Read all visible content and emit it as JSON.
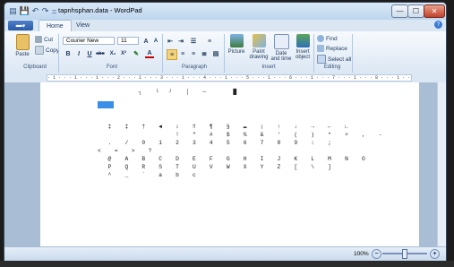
{
  "window": {
    "title": "tapnhsphan.data - WordPad",
    "controls": {
      "minimize": "—",
      "maximize": "☐",
      "close": "✕"
    }
  },
  "quick_access": {
    "save_icon": "💾",
    "undo_icon": "↶",
    "redo_icon": "↷",
    "menu_icon": "="
  },
  "tabs": {
    "file": "▾",
    "home": "Home",
    "view": "View",
    "help": "?"
  },
  "clipboard": {
    "paste": "Paste",
    "cut": "Cut",
    "copy": "Copy",
    "label": "Clipboard"
  },
  "font": {
    "family": "Courier New",
    "size": "11",
    "label": "Font",
    "bold": "B",
    "italic": "I",
    "underline": "U",
    "strike": "abc",
    "subscript": "X₂",
    "superscript": "X²",
    "grow": "A",
    "shrink": "A"
  },
  "paragraph": {
    "label": "Paragraph"
  },
  "insert": {
    "picture": "Picture",
    "paint": "Paint drawing",
    "datetime": "Date and time",
    "object": "Insert object",
    "label": "Insert"
  },
  "editing": {
    "find": "Find",
    "replace": "Replace",
    "select_all": "Select all",
    "label": "Editing"
  },
  "ruler": {
    "text": "· 1 · · · 1 · · · 1 · · · 2 · · · 1 · · · 3 · · · 1 · · · 4 · · · 1 · · · 5 · · · 1 · · · 6 · · · 1 · · · 7 · · · 1 · · · 8 · · · 1 · · · 9 · · ·"
  },
  "document": {
    "lines": [
      "           ┐    └   ┘    │    ─        █",
      "",
      "",
      "  ‡    ‡    †    ◄    ↕    ‼    ¶    §    ▬    ↨    ↑    ↓    →    ←    ∟",
      "                      !    \"    #    $    %    &    '    (    )    *    +    ,    -",
      "  .    /    0    1    2    3    4    5    6    7    8    9    :    ;",
      "<    =    >    ?",
      "  @    A    B    C    D    E    F    G    H    I    J    K    L    M    N    O",
      "  P    Q    R    S    T    U    V    W    X    Y    Z    [    \\    ]",
      "  ^    _    `    a    b    c"
    ]
  },
  "status": {
    "zoom": "100%",
    "zoom_out": "−",
    "zoom_in": "+"
  }
}
